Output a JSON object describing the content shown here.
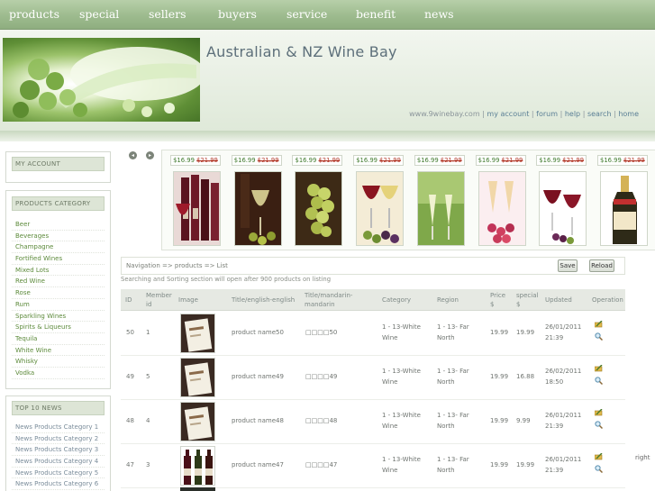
{
  "nav": [
    "products",
    "special",
    "sellers",
    "buyers",
    "service",
    "benefit",
    "news"
  ],
  "header": {
    "title": "Australian & NZ Wine Bay",
    "links": [
      "www.9winebay.com",
      "my account",
      "forum",
      "help",
      "search",
      "home"
    ],
    "link_separator": "|"
  },
  "sidebar": {
    "account_title": "MY ACCOUNT",
    "category_title": "PRODUCTS CATEGORY",
    "categories": [
      "Beer",
      "Beverages",
      "Champagne",
      "Fortified Wines",
      "Mixed Lots",
      "Red Wine",
      "Rose",
      "Rum",
      "Sparkling Wines",
      "Spirits & Liqueurs",
      "Tequila",
      "White Wine",
      "Whisky",
      "Vodka"
    ],
    "news_title": "TOP 10 NEWS",
    "news": [
      "News Products Category 1",
      "News Products Category 2",
      "News Products Category 3",
      "News Products Category 4",
      "News Products Category 5",
      "News Products Category 6"
    ]
  },
  "carousel": {
    "items": [
      {
        "price": "$16.99",
        "old_price": "$21.99",
        "image": "red-wine-bottles-glass"
      },
      {
        "price": "$16.99",
        "old_price": "$21.99",
        "image": "white-wine-glass-olives"
      },
      {
        "price": "$16.99",
        "old_price": "$21.99",
        "image": "green-grapes"
      },
      {
        "price": "$16.99",
        "old_price": "$21.99",
        "image": "wine-glasses-grapes"
      },
      {
        "price": "$16.99",
        "old_price": "$21.99",
        "image": "sparkling-glasses-vine"
      },
      {
        "price": "$16.99",
        "old_price": "$21.99",
        "image": "champagne-glasses-raspberries"
      },
      {
        "price": "$16.99",
        "old_price": "$21.99",
        "image": "red-wine-glasses-grapes"
      },
      {
        "price": "$16.99",
        "old_price": "$21.99",
        "image": "champagne-bottle"
      }
    ]
  },
  "navbar": {
    "path": "Navigation => products => List",
    "save_label": "Save",
    "reload_label": "Reload"
  },
  "note": "Searching and Sorting section will open after 900 products on listing",
  "table": {
    "headers": {
      "id": "ID",
      "member_id": "Member id",
      "image": "Image",
      "title_en": "Title/english-english",
      "title_zh": "Title/mandarin-mandarin",
      "category": "Category",
      "region": "Region",
      "price": "Price $",
      "special": "special $",
      "updated": "Updated",
      "operation": "Operation"
    },
    "rows": [
      {
        "id": "50",
        "member_id": "1",
        "title_en": "product name50",
        "title_zh": "□□□□50",
        "category": "1 - 13-White Wine",
        "region": "1 - 13- Far North",
        "price": "19.99",
        "special": "19.99",
        "updated": "26/01/2011 21:39",
        "image": "wine-label"
      },
      {
        "id": "49",
        "member_id": "5",
        "title_en": "product name49",
        "title_zh": "□□□□49",
        "category": "1 - 13-White Wine",
        "region": "1 - 13- Far North",
        "price": "19.99",
        "special": "16.88",
        "updated": "26/02/2011 18:50",
        "image": "wine-label"
      },
      {
        "id": "48",
        "member_id": "4",
        "title_en": "product name48",
        "title_zh": "□□□□48",
        "category": "1 - 13-White Wine",
        "region": "1 - 13- Far North",
        "price": "19.99",
        "special": "9.99",
        "updated": "26/01/2011 21:39",
        "image": "wine-label"
      },
      {
        "id": "47",
        "member_id": "3",
        "title_en": "product name47",
        "title_zh": "□□□□47",
        "category": "1 - 13-White Wine",
        "region": "1 - 13- Far North",
        "price": "19.99",
        "special": "19.99",
        "updated": "26/01/2011 21:39",
        "image": "wine-bottles-row"
      }
    ],
    "edit_icon": "edit-icon",
    "view_icon": "magnifier-icon"
  },
  "edge_text": "right",
  "colors": {
    "nav_green": "#9dbb8e",
    "link_green": "#5c8a3a",
    "price_green": "#3f7a2c",
    "old_price_red": "#b33a2a"
  }
}
